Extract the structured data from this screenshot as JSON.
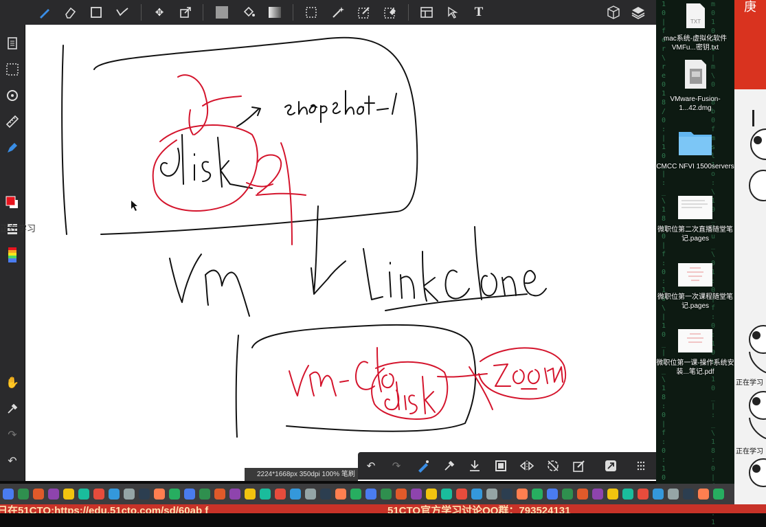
{
  "toolbar": {
    "tools": [
      "brush-icon",
      "eraser-icon",
      "rectangle-icon",
      "curve-icon",
      "move-icon",
      "transform-icon",
      "fill-swatch-icon",
      "bucket-icon",
      "gradient-icon",
      "marquee-select-icon",
      "magic-wand-icon",
      "selection-pen-icon",
      "selection-eraser-icon",
      "canvas-icon",
      "select-arrow-icon",
      "text-icon",
      "layers-3d-icon",
      "layers-icon"
    ]
  },
  "left_tools": [
    "document-icon",
    "selection-icon",
    "rotate-icon",
    "ruler-icon",
    "pen-icon",
    "color-swatch-icon",
    "layer-list-icon",
    "rainbow-icon",
    "hand-icon",
    "eyedropper-icon",
    "redo-icon",
    "undo-icon"
  ],
  "colors": {
    "primary": "#e8141e",
    "secondary": "#ffffff",
    "ink_black": "#111111",
    "ink_red": "#d4142c"
  },
  "overlay_text": "正在学习",
  "desktop": {
    "items": [
      {
        "icon": "txt-file-icon",
        "badge": "TXT",
        "label": "mac系统-虚拟化软件 VMFu...密钥.txt"
      },
      {
        "icon": "dmg-file-icon",
        "label": "VMware-Fusion-1...42.dmg"
      },
      {
        "icon": "folder-icon",
        "label": "CMCC NFVI 1500servers"
      },
      {
        "icon": "pages-file-icon",
        "label": "微职位第二次直播随堂笔记.pages"
      },
      {
        "icon": "pages-file-icon",
        "label": "微职位第一次课程随堂笔记.pages"
      },
      {
        "icon": "pdf-file-icon",
        "label": "微职位第一课-操作系统安装...笔记.pdf"
      }
    ]
  },
  "right_strip": {
    "labels": [
      "正在学习",
      "正在学习"
    ],
    "top_glyph": "庚"
  },
  "status_bar": "2224*1668px 350dpi 100% 笔刷",
  "float_toolbar": [
    "undo-icon",
    "redo-icon",
    "pen-tool-icon",
    "eyedropper-icon",
    "download-icon",
    "crop-icon",
    "flip-icon",
    "no-rotate-icon",
    "edit-icon",
    "share-icon",
    "more-icon"
  ],
  "marquee": {
    "left": "日在51CTO:https://edu.51cto.com/sd/60ab f",
    "right": "51CTO官方学习讨论QQ群：793524131"
  },
  "drawing": {
    "words": [
      "snapshot-1",
      "disk",
      "VM",
      "link clone",
      "VM-clone",
      "disk",
      "Zoom"
    ]
  }
}
